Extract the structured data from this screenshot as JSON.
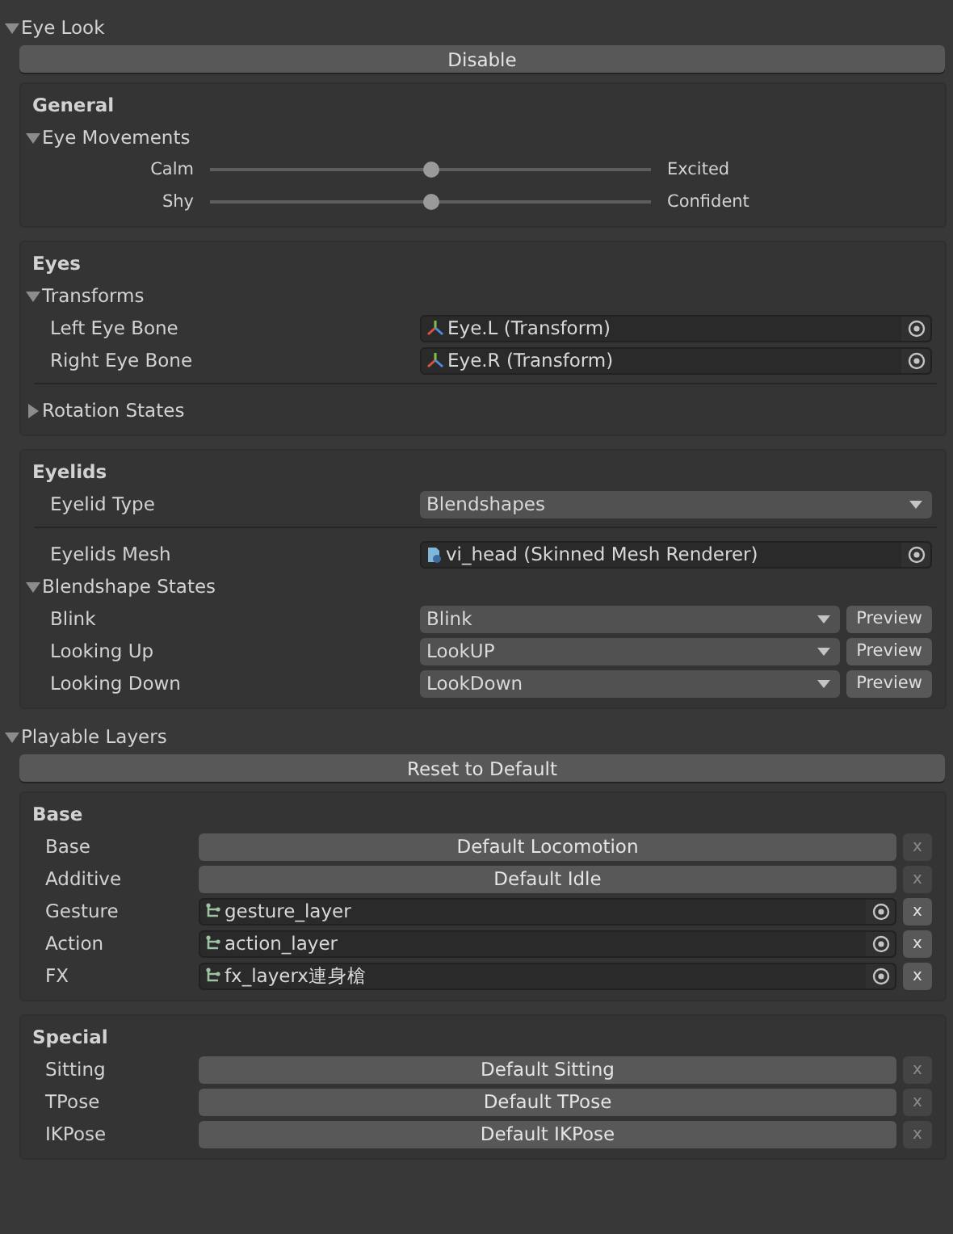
{
  "sections": [
    {
      "title": "Eye Look",
      "expanded": true,
      "action": "Disable",
      "groups": [
        {
          "title": "General",
          "items": [
            {
              "kind": "foldout",
              "label": "Eye Movements",
              "expanded": true,
              "children": [
                {
                  "kind": "slider",
                  "left": "Calm",
                  "right": "Excited",
                  "level": 0.5
                },
                {
                  "kind": "slider",
                  "left": "Shy",
                  "right": "Confident",
                  "level": 0.5
                }
              ]
            }
          ]
        },
        {
          "title": "Eyes",
          "items": [
            {
              "kind": "foldout",
              "label": "Transforms",
              "expanded": true,
              "children": [
                {
                  "kind": "transform",
                  "label": "Left Eye Bone",
                  "value": "Eye.L (Transform)"
                },
                {
                  "kind": "transform",
                  "label": "Right Eye Bone",
                  "value": "Eye.R (Transform)"
                }
              ]
            },
            {
              "kind": "separator"
            },
            {
              "kind": "foldout",
              "label": "Rotation States",
              "expanded": false
            }
          ]
        },
        {
          "title": "Eyelids",
          "items": [
            {
              "kind": "dropdown",
              "label": "Eyelid Type",
              "value": "Blendshapes"
            },
            {
              "kind": "separator"
            },
            {
              "kind": "mesh",
              "label": "Eyelids Mesh",
              "value": "vi_head (Skinned Mesh Renderer)"
            },
            {
              "kind": "foldout",
              "label": "Blendshape States",
              "expanded": true,
              "children": [
                {
                  "kind": "dropdown",
                  "label": "Blink",
                  "value": "Blink",
                  "preview": "Preview"
                },
                {
                  "kind": "dropdown",
                  "label": "Looking Up",
                  "value": "LookUP",
                  "preview": "Preview"
                },
                {
                  "kind": "dropdown",
                  "label": "Looking Down",
                  "value": "LookDown",
                  "preview": "Preview"
                }
              ]
            }
          ]
        }
      ]
    },
    {
      "title": "Playable Layers",
      "expanded": true,
      "action": "Reset to Default",
      "groups": [
        {
          "title": "Base",
          "items": [
            {
              "kind": "default",
              "label": "Base",
              "value": "Default Locomotion",
              "clear": "x",
              "disabled": true
            },
            {
              "kind": "default",
              "label": "Additive",
              "value": "Default Idle",
              "clear": "x",
              "disabled": true
            },
            {
              "kind": "controller",
              "label": "Gesture",
              "value": "gesture_layer",
              "clear": "x",
              "disabled": false
            },
            {
              "kind": "controller",
              "label": "Action",
              "value": "action_layer",
              "clear": "x",
              "disabled": false
            },
            {
              "kind": "controller",
              "label": "FX",
              "value": "fx_layerx連身槍",
              "clear": "x",
              "disabled": false
            }
          ]
        },
        {
          "title": "Special",
          "items": [
            {
              "kind": "default",
              "label": "Sitting",
              "value": "Default Sitting",
              "clear": "x",
              "disabled": true
            },
            {
              "kind": "default",
              "label": "TPose",
              "value": "Default TPose",
              "clear": "x",
              "disabled": true
            },
            {
              "kind": "default",
              "label": "IKPose",
              "value": "Default IKPose",
              "clear": "x",
              "disabled": true
            }
          ]
        }
      ]
    }
  ]
}
